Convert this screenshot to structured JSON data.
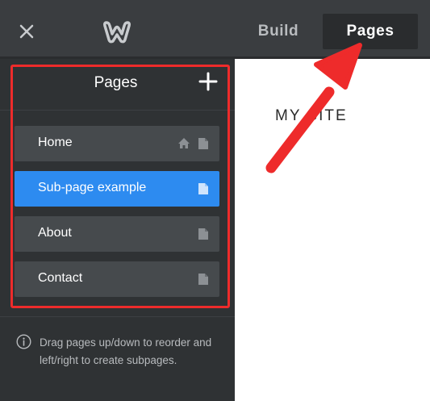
{
  "topbar": {
    "tabs": [
      {
        "label": "Build",
        "active": false
      },
      {
        "label": "Pages",
        "active": true
      }
    ]
  },
  "pages_panel": {
    "title": "Pages",
    "items": [
      {
        "label": "Home",
        "selected": false,
        "is_home": true
      },
      {
        "label": "Sub-page example",
        "selected": true,
        "is_home": false
      },
      {
        "label": "About",
        "selected": false,
        "is_home": false
      },
      {
        "label": "Contact",
        "selected": false,
        "is_home": false
      }
    ],
    "hint": "Drag pages up/down to reorder and left/right to create subpages."
  },
  "canvas": {
    "site_name": "MY SITE"
  },
  "icons": {
    "close": "close-icon",
    "logo": "weebly-logo-icon",
    "add": "plus-icon",
    "home": "home-icon",
    "page": "page-icon",
    "info": "info-icon"
  },
  "colors": {
    "topbar": "#3a3d40",
    "sidebar": "#2f3234",
    "item": "#464a4d",
    "selected": "#2d8bf0",
    "annotation": "#ee2b2b"
  }
}
